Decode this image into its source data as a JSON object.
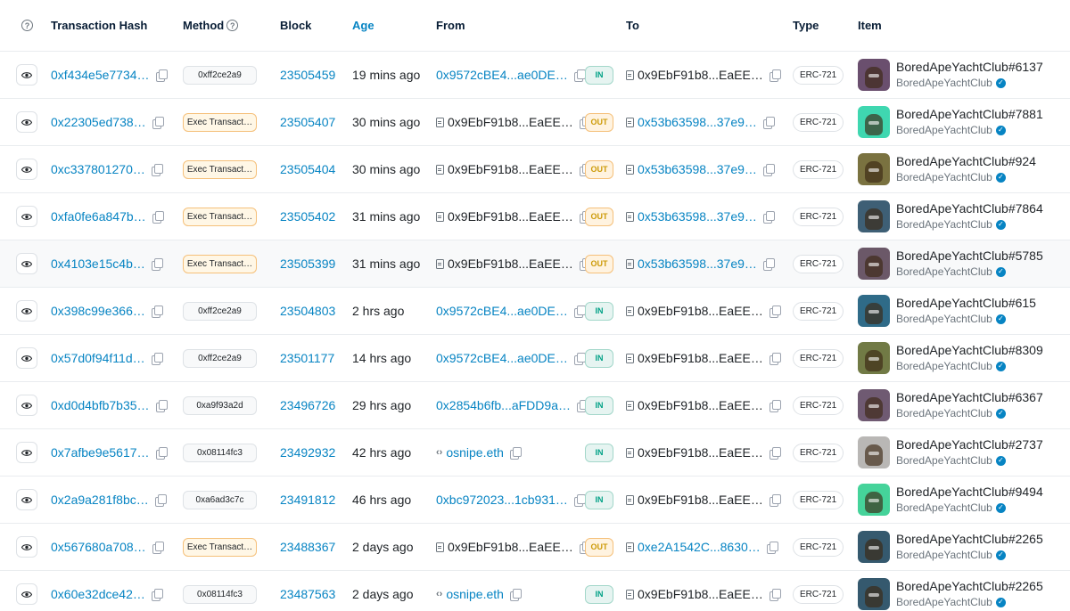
{
  "header": {
    "hash": "Transaction Hash",
    "method": "Method",
    "block": "Block",
    "age": "Age",
    "from": "From",
    "to": "To",
    "type": "Type",
    "item": "Item"
  },
  "colors": {
    "link": "#0784c3",
    "in": "#00a186",
    "out": "#cc9a06"
  },
  "rows": [
    {
      "hash": "0xf434e5e7734…",
      "method": "0xff2ce2a9",
      "method_kind": "plain",
      "block": "23505459",
      "age": "19 mins ago",
      "from": "0x9572cBE4...ae0DE…",
      "from_kind": "link",
      "dir": "IN",
      "to": "0x9EbF91b8...EaEE…",
      "to_kind": "contract",
      "type": "ERC-721",
      "item": "BoredApeYachtClub#6137",
      "collection": "BoredApeYachtClub",
      "avatar_color": "#6a4f6e"
    },
    {
      "hash": "0x22305ed738…",
      "method": "Exec Transact…",
      "method_kind": "exec",
      "block": "23505407",
      "age": "30 mins ago",
      "from": "0x9EbF91b8...EaEE…",
      "from_kind": "contract",
      "dir": "OUT",
      "to": "0x53b63598...37e9…",
      "to_kind": "contract-link",
      "type": "ERC-721",
      "item": "BoredApeYachtClub#7881",
      "collection": "BoredApeYachtClub",
      "avatar_color": "#3fd7b0"
    },
    {
      "hash": "0xc337801270…",
      "method": "Exec Transact…",
      "method_kind": "exec",
      "block": "23505404",
      "age": "30 mins ago",
      "from": "0x9EbF91b8...EaEE…",
      "from_kind": "contract",
      "dir": "OUT",
      "to": "0x53b63598...37e9…",
      "to_kind": "contract-link",
      "type": "ERC-721",
      "item": "BoredApeYachtClub#924",
      "collection": "BoredApeYachtClub",
      "avatar_color": "#7a7240"
    },
    {
      "hash": "0xfa0fe6a847b…",
      "method": "Exec Transact…",
      "method_kind": "exec",
      "block": "23505402",
      "age": "31 mins ago",
      "from": "0x9EbF91b8...EaEE…",
      "from_kind": "contract",
      "dir": "OUT",
      "to": "0x53b63598...37e9…",
      "to_kind": "contract-link",
      "type": "ERC-721",
      "item": "BoredApeYachtClub#7864",
      "collection": "BoredApeYachtClub",
      "avatar_color": "#3e5f75"
    },
    {
      "hash": "0x4103e15c4b…",
      "method": "Exec Transact…",
      "method_kind": "exec",
      "block": "23505399",
      "age": "31 mins ago",
      "from": "0x9EbF91b8...EaEE…",
      "from_kind": "contract",
      "dir": "OUT",
      "to": "0x53b63598...37e9…",
      "to_kind": "contract-link",
      "type": "ERC-721",
      "item": "BoredApeYachtClub#5785",
      "collection": "BoredApeYachtClub",
      "avatar_color": "#6b5868"
    },
    {
      "hash": "0x398c99e366…",
      "method": "0xff2ce2a9",
      "method_kind": "plain",
      "block": "23504803",
      "age": "2 hrs ago",
      "from": "0x9572cBE4...ae0DE…",
      "from_kind": "link",
      "dir": "IN",
      "to": "0x9EbF91b8...EaEE…",
      "to_kind": "contract",
      "type": "ERC-721",
      "item": "BoredApeYachtClub#615",
      "collection": "BoredApeYachtClub",
      "avatar_color": "#2f6b88"
    },
    {
      "hash": "0x57d0f94f11d…",
      "method": "0xff2ce2a9",
      "method_kind": "plain",
      "block": "23501177",
      "age": "14 hrs ago",
      "from": "0x9572cBE4...ae0DE…",
      "from_kind": "link",
      "dir": "IN",
      "to": "0x9EbF91b8...EaEE…",
      "to_kind": "contract",
      "type": "ERC-721",
      "item": "BoredApeYachtClub#8309",
      "collection": "BoredApeYachtClub",
      "avatar_color": "#717a45"
    },
    {
      "hash": "0xd0d4bfb7b35…",
      "method": "0xa9f93a2d",
      "method_kind": "plain",
      "block": "23496726",
      "age": "29 hrs ago",
      "from": "0x2854b6fb...aFDD9a…",
      "from_kind": "link",
      "dir": "IN",
      "to": "0x9EbF91b8...EaEE…",
      "to_kind": "contract",
      "type": "ERC-721",
      "item": "BoredApeYachtClub#6367",
      "collection": "BoredApeYachtClub",
      "avatar_color": "#6f5a72"
    },
    {
      "hash": "0x7afbe9e5617…",
      "method": "0x08114fc3",
      "method_kind": "plain",
      "block": "23492932",
      "age": "42 hrs ago",
      "from": "osnipe.eth",
      "from_kind": "ens",
      "dir": "IN",
      "to": "0x9EbF91b8...EaEE…",
      "to_kind": "contract",
      "type": "ERC-721",
      "item": "BoredApeYachtClub#2737",
      "collection": "BoredApeYachtClub",
      "avatar_color": "#b9b7b5"
    },
    {
      "hash": "0x2a9a281f8bc…",
      "method": "0xa6ad3c7c",
      "method_kind": "plain",
      "block": "23491812",
      "age": "46 hrs ago",
      "from": "0xbc972023...1cb931…",
      "from_kind": "link",
      "dir": "IN",
      "to": "0x9EbF91b8...EaEE…",
      "to_kind": "contract",
      "type": "ERC-721",
      "item": "BoredApeYachtClub#9494",
      "collection": "BoredApeYachtClub",
      "avatar_color": "#45d39a"
    },
    {
      "hash": "0x567680a708…",
      "method": "Exec Transact…",
      "method_kind": "exec",
      "block": "23488367",
      "age": "2 days ago",
      "from": "0x9EbF91b8...EaEE…",
      "from_kind": "contract",
      "dir": "OUT",
      "to": "0xe2A1542C...8630…",
      "to_kind": "contract-link",
      "type": "ERC-721",
      "item": "BoredApeYachtClub#2265",
      "collection": "BoredApeYachtClub",
      "avatar_color": "#35596e"
    },
    {
      "hash": "0x60e32dce42…",
      "method": "0x08114fc3",
      "method_kind": "plain",
      "block": "23487563",
      "age": "2 days ago",
      "from": "osnipe.eth",
      "from_kind": "ens",
      "dir": "IN",
      "to": "0x9EbF91b8...EaEE…",
      "to_kind": "contract",
      "type": "ERC-721",
      "item": "BoredApeYachtClub#2265",
      "collection": "BoredApeYachtClub",
      "avatar_color": "#35596e"
    }
  ]
}
